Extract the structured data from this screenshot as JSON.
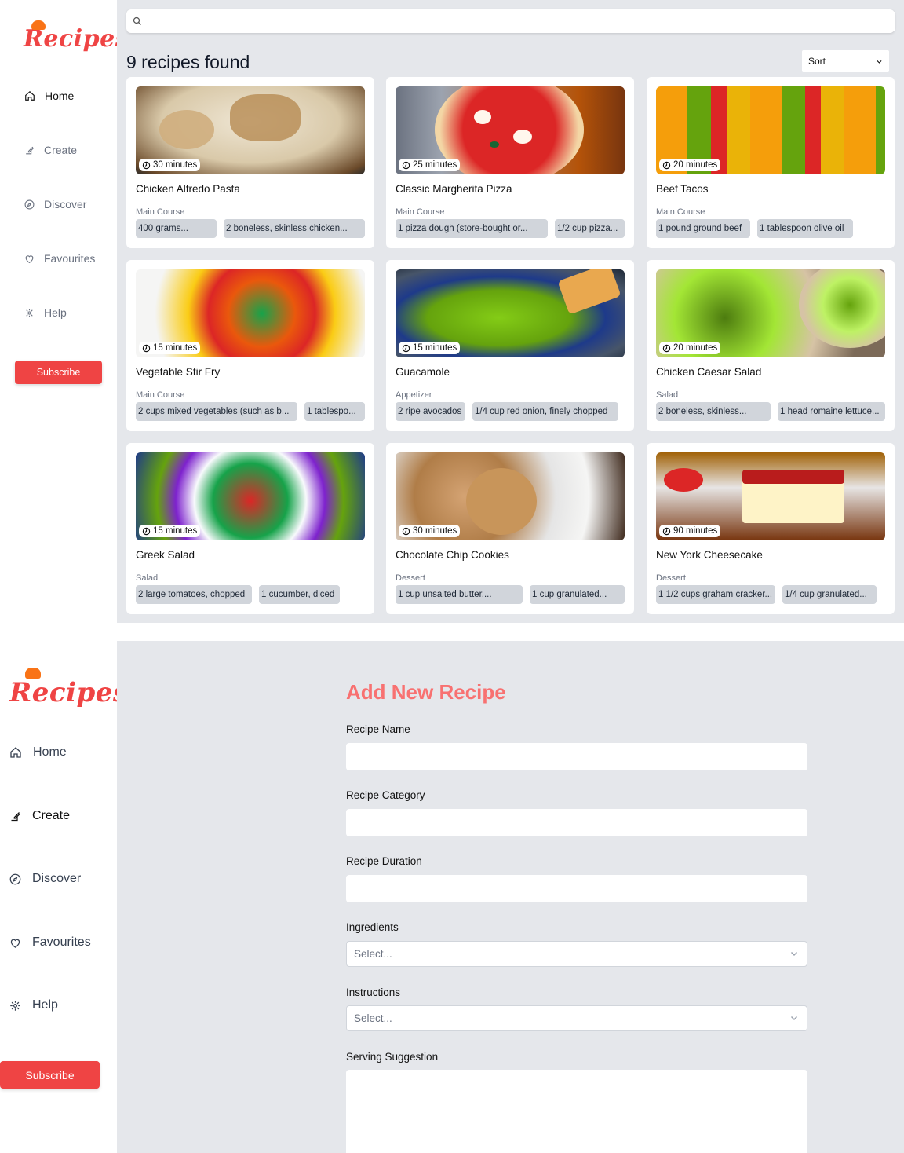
{
  "app": {
    "logo_text": "Recipes"
  },
  "nav": {
    "home": "Home",
    "create": "Create",
    "discover": "Discover",
    "favourites": "Favourites",
    "help": "Help",
    "subscribe": "Subscribe"
  },
  "list": {
    "search_placeholder": "",
    "count_label": "9 recipes found",
    "sort_label": "Sort",
    "recipes": [
      {
        "title": "Chicken Alfredo Pasta",
        "duration": "30 minutes",
        "category": "Main Course",
        "ingredients": [
          "400 grams...",
          "2 boneless, skinless chicken..."
        ]
      },
      {
        "title": "Classic Margherita Pizza",
        "duration": "25 minutes",
        "category": "Main Course",
        "ingredients": [
          "1 pizza dough (store-bought or...",
          "1/2 cup pizza..."
        ]
      },
      {
        "title": "Beef Tacos",
        "duration": "20 minutes",
        "category": "Main Course",
        "ingredients": [
          "1 pound ground beef",
          "1 tablespoon olive oil"
        ]
      },
      {
        "title": "Vegetable Stir Fry",
        "duration": "15 minutes",
        "category": "Main Course",
        "ingredients": [
          "2 cups mixed vegetables (such as b...",
          "1 tablespo..."
        ]
      },
      {
        "title": "Guacamole",
        "duration": "15 minutes",
        "category": "Appetizer",
        "ingredients": [
          "2 ripe avocados",
          "1/4 cup red onion, finely chopped"
        ]
      },
      {
        "title": "Chicken Caesar Salad",
        "duration": "20 minutes",
        "category": "Salad",
        "ingredients": [
          "2 boneless, skinless...",
          "1 head romaine lettuce..."
        ]
      },
      {
        "title": "Greek Salad",
        "duration": "15 minutes",
        "category": "Salad",
        "ingredients": [
          "2 large tomatoes, chopped",
          "1 cucumber, diced"
        ]
      },
      {
        "title": "Chocolate Chip Cookies",
        "duration": "30 minutes",
        "category": "Dessert",
        "ingredients": [
          "1 cup unsalted butter,...",
          "1 cup granulated..."
        ]
      },
      {
        "title": "New York Cheesecake",
        "duration": "90 minutes",
        "category": "Dessert",
        "ingredients": [
          "1 1/2 cups graham cracker...",
          "1/4 cup granulated..."
        ]
      }
    ]
  },
  "form": {
    "title": "Add New Recipe",
    "name_label": "Recipe Name",
    "category_label": "Recipe Category",
    "duration_label": "Recipe Duration",
    "ingredients_label": "Ingredients",
    "ingredients_placeholder": "Select...",
    "instructions_label": "Instructions",
    "instructions_placeholder": "Select...",
    "serving_label": "Serving Suggestion"
  },
  "colors": {
    "accent": "#ef4444",
    "title": "#f87171",
    "background": "#e5e7eb"
  }
}
